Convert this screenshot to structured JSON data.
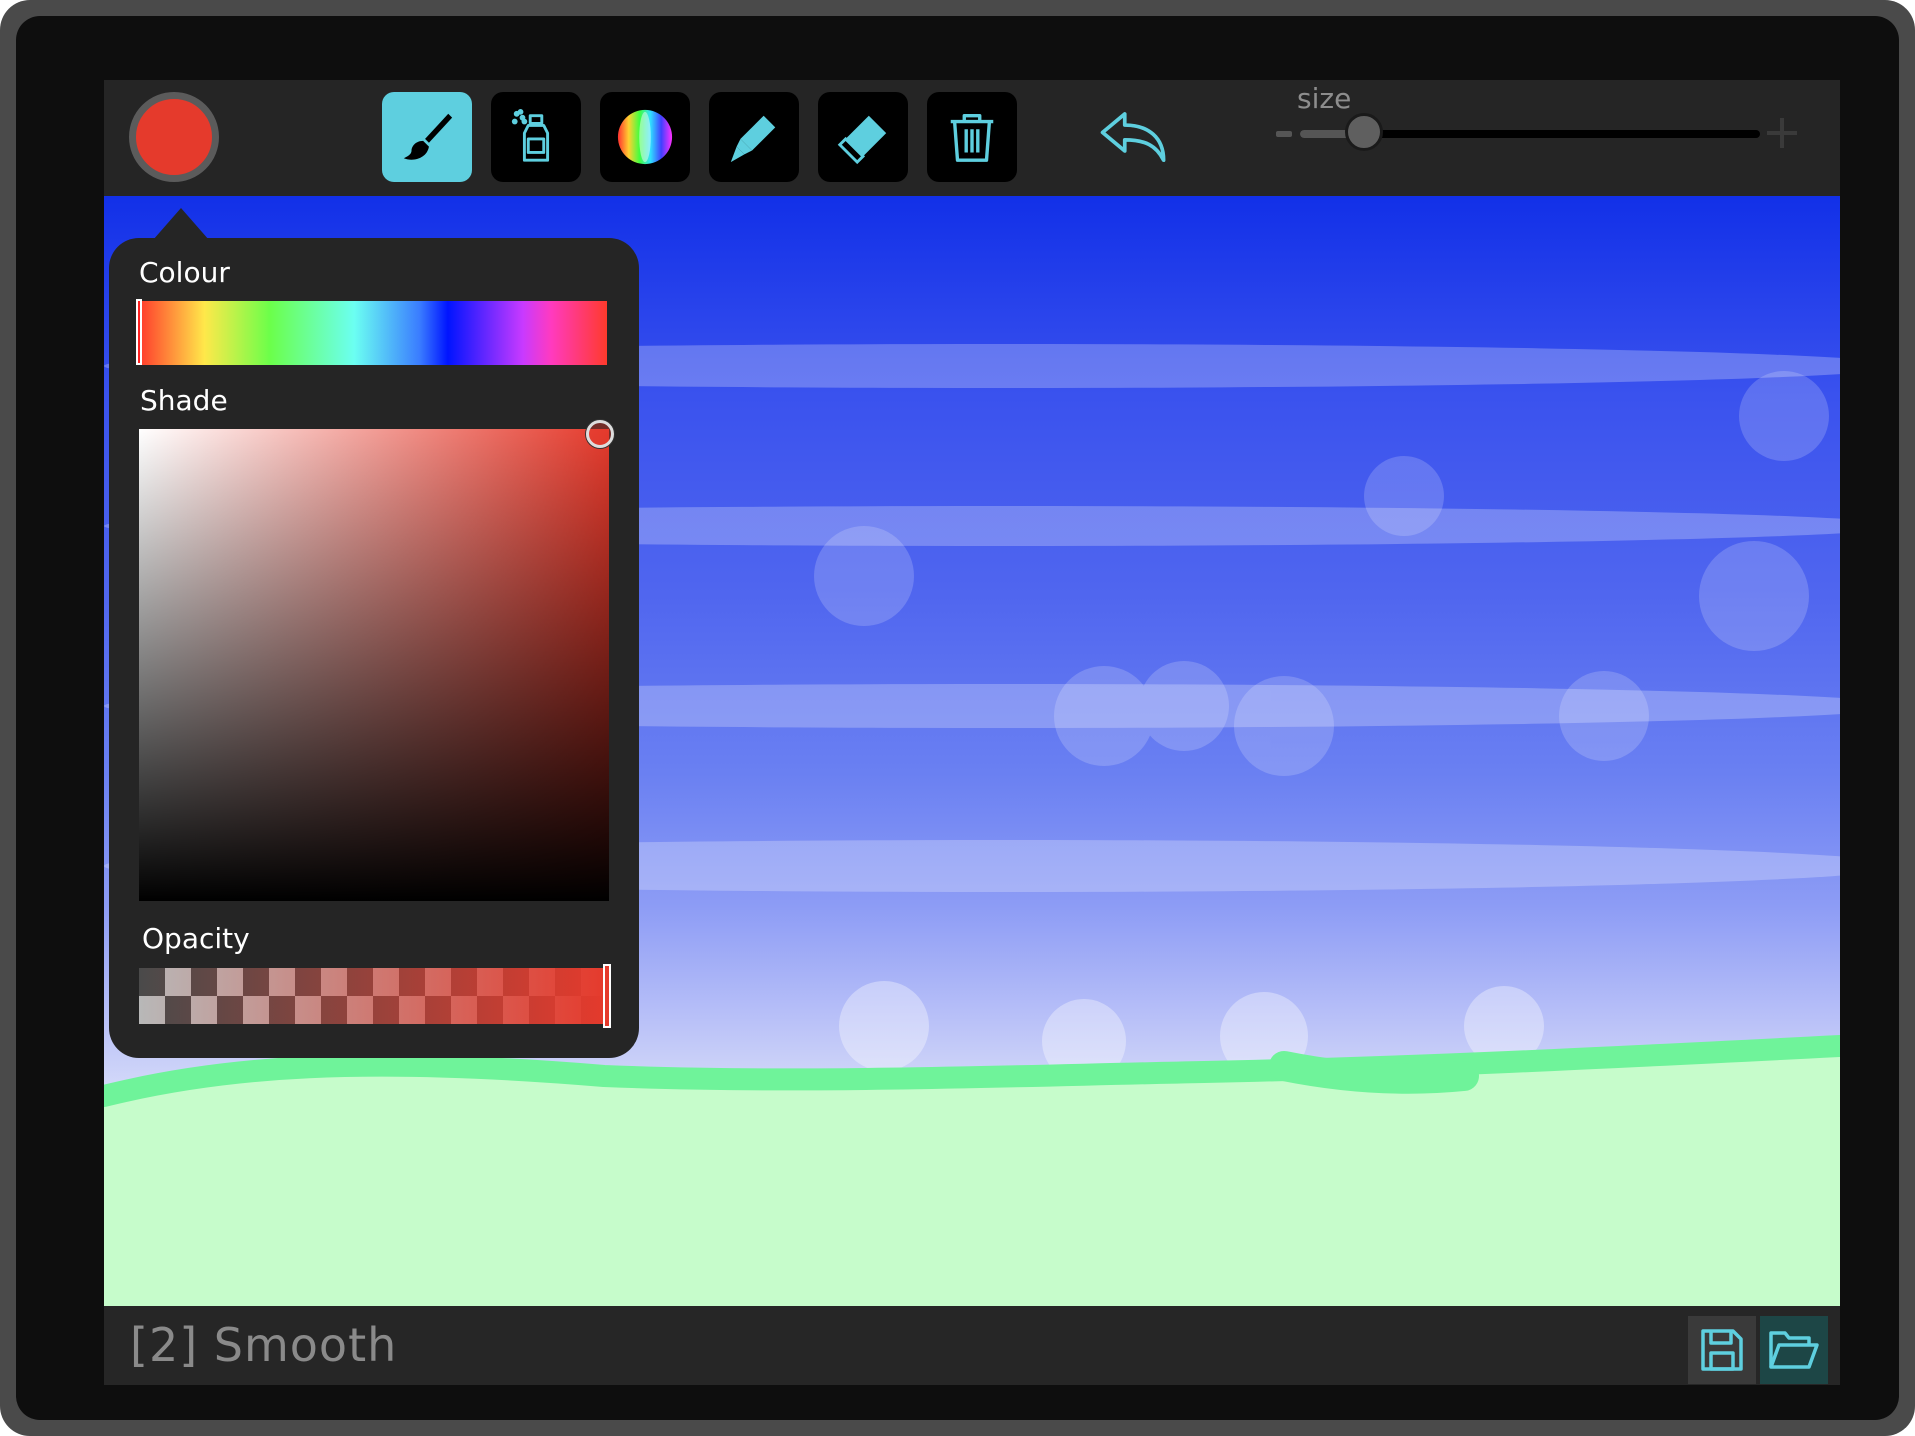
{
  "toolbar": {
    "current_color": "#e53a2c",
    "tools": [
      {
        "name": "brush",
        "icon": "paintbrush-icon",
        "active": true
      },
      {
        "name": "spray",
        "icon": "spray-can-icon",
        "active": false
      },
      {
        "name": "rainbow",
        "icon": "rainbow-color-icon",
        "active": false
      },
      {
        "name": "marker",
        "icon": "marker-pen-icon",
        "active": false
      },
      {
        "name": "eraser",
        "icon": "eraser-icon",
        "active": false
      },
      {
        "name": "clear",
        "icon": "trash-icon",
        "active": false
      }
    ],
    "undo_icon": "undo-arrow-icon",
    "size": {
      "label": "size",
      "value": 0.14
    }
  },
  "color_picker": {
    "colour_label": "Colour",
    "shade_label": "Shade",
    "opacity_label": "Opacity",
    "hue": 0.0,
    "saturation": 0.98,
    "brightness": 0.99,
    "opacity": 1.0
  },
  "bottom_bar": {
    "mode_text": "[2] Smooth",
    "save_icon": "save-icon",
    "open_icon": "folder-open-icon"
  },
  "colors": {
    "accent": "#5ecfdf",
    "sky_top": "#1230e8",
    "grass": "#c6fccb",
    "grass_line": "#6ff39a"
  }
}
